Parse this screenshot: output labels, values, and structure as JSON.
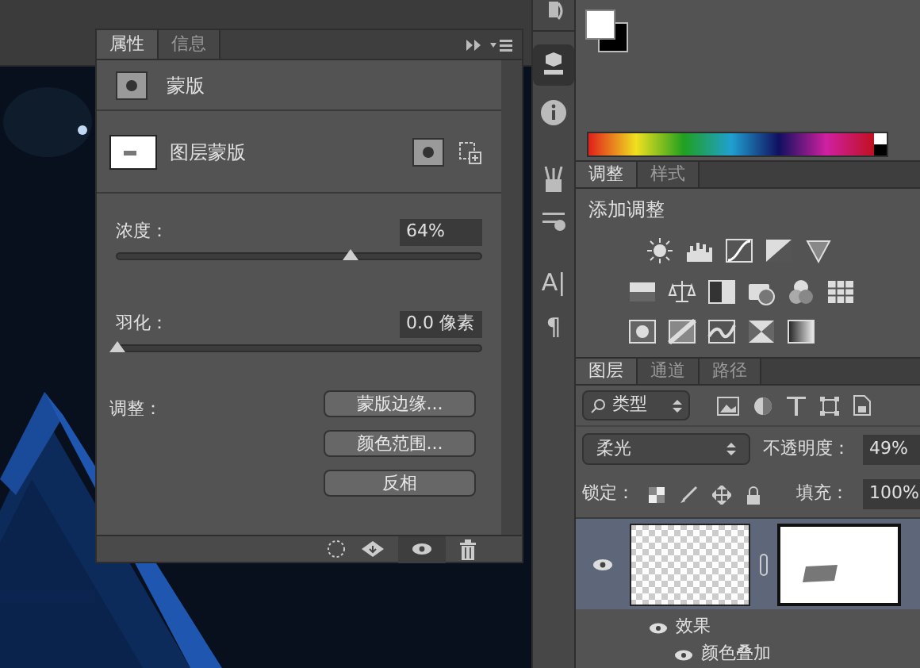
{
  "properties_panel": {
    "tabs": [
      {
        "label": "属性",
        "selected": true
      },
      {
        "label": "信息",
        "selected": false
      }
    ],
    "header": "蒙版",
    "mask_label": "图层蒙版",
    "sliders": [
      {
        "label": "浓度：",
        "value": "64%",
        "level": 0.64
      },
      {
        "label": "羽化：",
        "value": "0.0 像素",
        "level": 0
      }
    ],
    "adjust_label": "调整：",
    "buttons": [
      "蒙版边缘...",
      "颜色范围...",
      "反相"
    ]
  },
  "tool_strip": {
    "glyphs": [
      "A|",
      "¶"
    ]
  },
  "adjustments_panel": {
    "tabs": [
      {
        "label": "调整",
        "selected": true
      },
      {
        "label": "样式",
        "selected": false
      }
    ],
    "title": "添加调整"
  },
  "layers_panel": {
    "tabs": [
      {
        "label": "图层",
        "selected": true
      },
      {
        "label": "通道",
        "selected": false
      },
      {
        "label": "路径",
        "selected": false
      }
    ],
    "filter": "类型",
    "blend_mode": "柔光",
    "opacity_label": "不透明度：",
    "opacity": "49%",
    "lock_label": "锁定：",
    "fill_label": "填充：",
    "fill": "100%",
    "layer": {
      "selected": true
    },
    "effects": [
      {
        "label": "效果"
      },
      {
        "label": "颜色叠加"
      }
    ]
  }
}
